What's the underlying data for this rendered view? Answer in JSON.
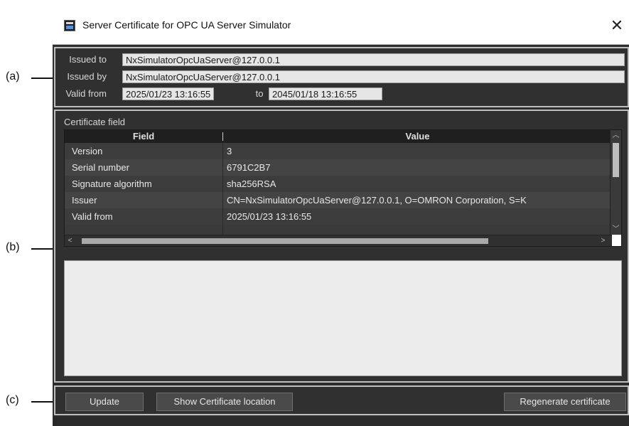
{
  "callouts": {
    "a": "(a)",
    "b": "(b)",
    "c": "(c)"
  },
  "window": {
    "title": "Server Certificate for OPC UA Server Simulator",
    "close_glyph": "✕",
    "icon": "app-icon"
  },
  "issuer": {
    "issued_to_label": "Issued to",
    "issued_to_value": "NxSimulatorOpcUaServer@127.0.0.1",
    "issued_by_label": "Issued by",
    "issued_by_value": "NxSimulatorOpcUaServer@127.0.0.1",
    "valid_from_label": "Valid from",
    "valid_from_value": "2025/01/23 13:16:55",
    "to_label": "to",
    "valid_to_value": "2045/01/18 13:16:55"
  },
  "certificate": {
    "section_title": "Certificate field",
    "columns": [
      "Field",
      "Value"
    ],
    "rows": [
      {
        "field": "Version",
        "value": "3"
      },
      {
        "field": "Serial number",
        "value": "6791C2B7"
      },
      {
        "field": "Signature algorithm",
        "value": "sha256RSA"
      },
      {
        "field": "Issuer",
        "value": "CN=NxSimulatorOpcUaServer@127.0.0.1, O=OMRON Corporation, S=K"
      },
      {
        "field": "Valid from",
        "value": "2025/01/23 13:16:55"
      }
    ],
    "scroll_up": "︿",
    "scroll_down": "﹀",
    "scroll_left": "<",
    "scroll_right": ">",
    "detail_text": ""
  },
  "buttons": {
    "update": "Update",
    "show_location": "Show Certificate location",
    "regenerate": "Regenerate certificate"
  },
  "colors": {
    "window_bg": "#2d2d2d",
    "field_bg": "#e6e6e6",
    "grid_header": "#1f1f1f"
  }
}
